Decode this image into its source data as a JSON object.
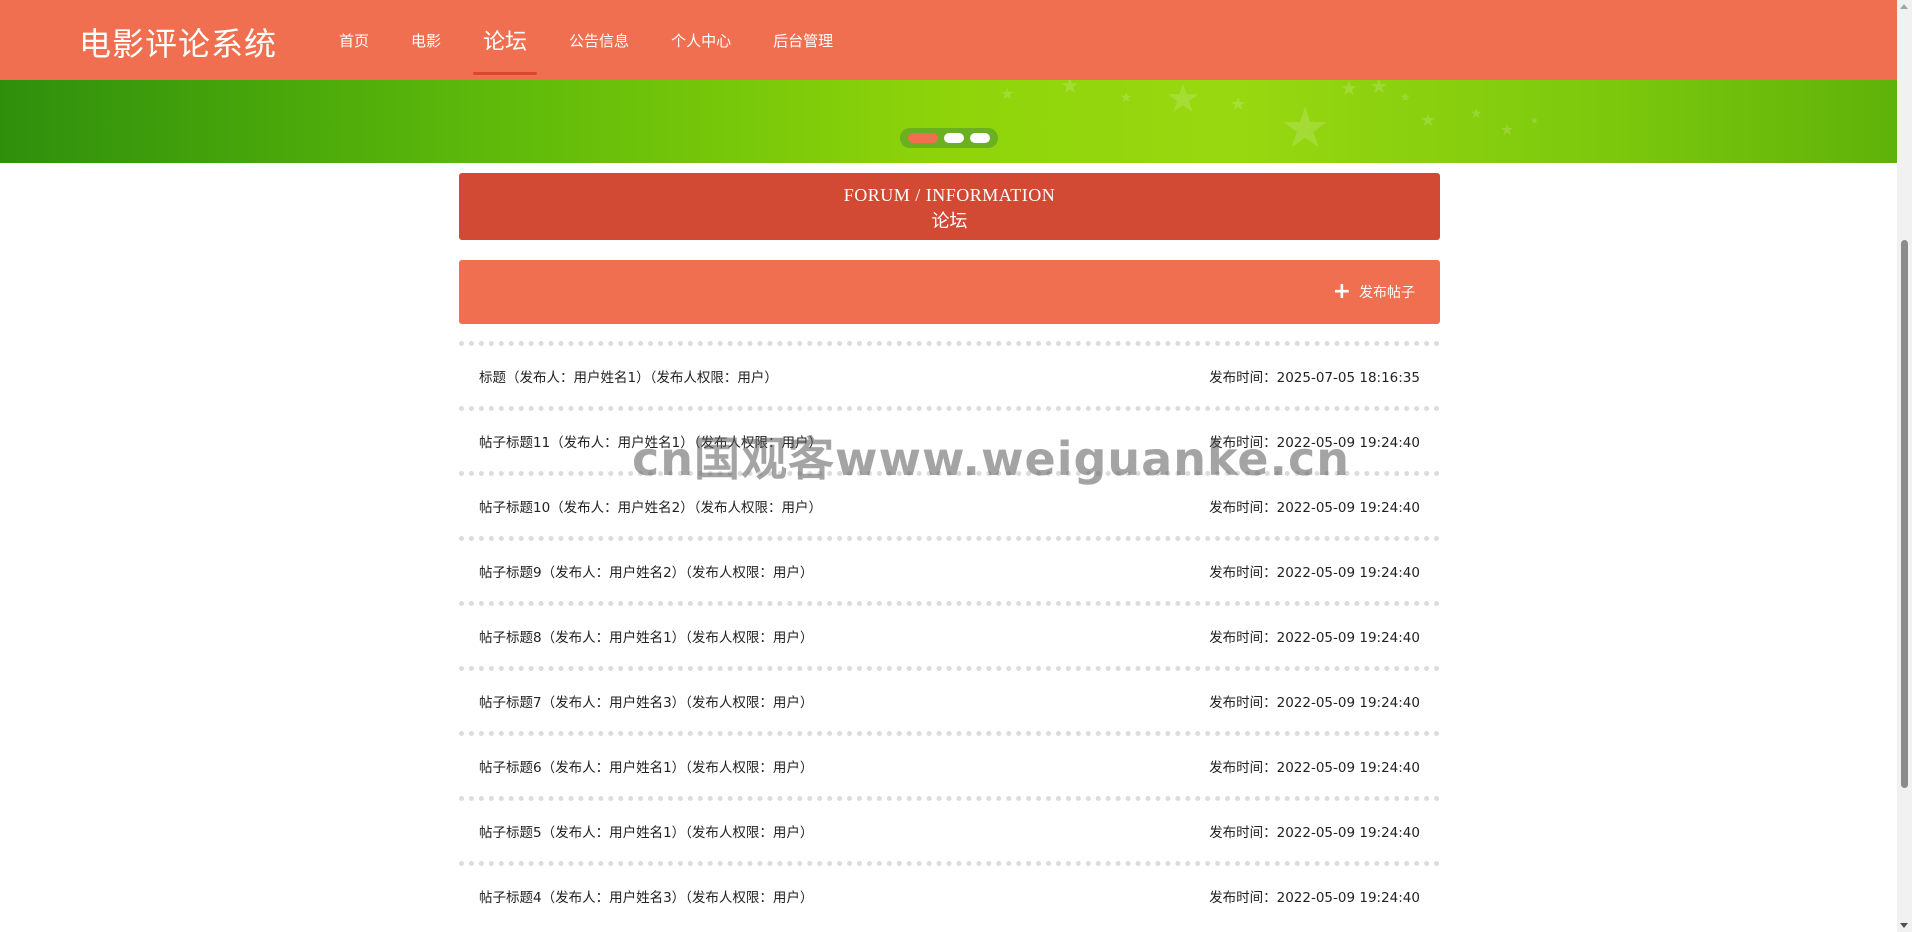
{
  "header": {
    "logo": "电影评论系统",
    "nav": [
      {
        "label": "首页"
      },
      {
        "label": "电影"
      },
      {
        "label": "论坛"
      },
      {
        "label": "公告信息"
      },
      {
        "label": "个人中心"
      },
      {
        "label": "后台管理"
      }
    ],
    "active_index": 2
  },
  "banner": {
    "slides_total": 3,
    "active_slide": 1
  },
  "section": {
    "title_en": "FORUM / INFORMATION",
    "title_cn": "论坛"
  },
  "actions": {
    "publish_label": "发布帖子",
    "icon": "plus-icon"
  },
  "posts": [
    {
      "title": "标题（发布人：用户姓名1）（发布人权限：用户）",
      "time": "发布时间：2025-07-05 18:16:35"
    },
    {
      "title": "帖子标题11（发布人：用户姓名1）（发布人权限：用户）",
      "time": "发布时间：2022-05-09 19:24:40"
    },
    {
      "title": "帖子标题10（发布人：用户姓名2）（发布人权限：用户）",
      "time": "发布时间：2022-05-09 19:24:40"
    },
    {
      "title": "帖子标题9（发布人：用户姓名2）（发布人权限：用户）",
      "time": "发布时间：2022-05-09 19:24:40"
    },
    {
      "title": "帖子标题8（发布人：用户姓名1）（发布人权限：用户）",
      "time": "发布时间：2022-05-09 19:24:40"
    },
    {
      "title": "帖子标题7（发布人：用户姓名3）（发布人权限：用户）",
      "time": "发布时间：2022-05-09 19:24:40"
    },
    {
      "title": "帖子标题6（发布人：用户姓名1）（发布人权限：用户）",
      "time": "发布时间：2022-05-09 19:24:40"
    },
    {
      "title": "帖子标题5（发布人：用户姓名1）（发布人权限：用户）",
      "time": "发布时间：2022-05-09 19:24:40"
    },
    {
      "title": "帖子标题4（发布人：用户姓名3）（发布人权限：用户）",
      "time": "发布时间：2022-05-09 19:24:40"
    }
  ],
  "watermark": "cn国观客www.weiguanke.cn",
  "colors": {
    "header": "#f06f50",
    "section_title": "#d24a33",
    "banner_green": "#8fd40a"
  }
}
